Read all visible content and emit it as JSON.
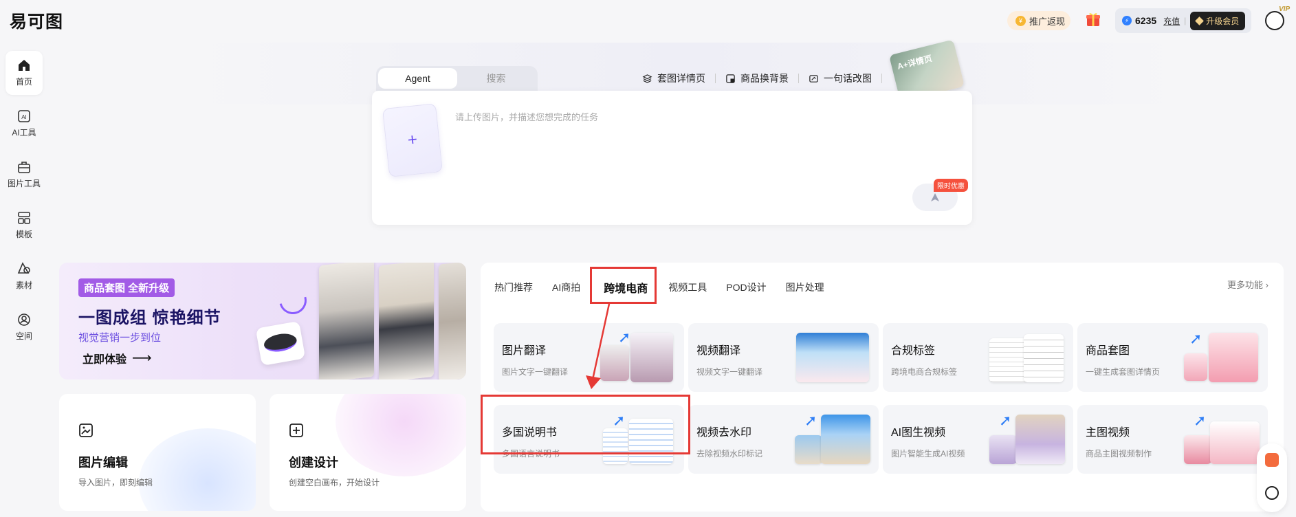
{
  "header": {
    "logo": "易可图",
    "promo_label": "推广返现",
    "credits": "6235",
    "recharge_label": "充值",
    "upgrade_label": "升级会员",
    "vip_tag": "VIP"
  },
  "sidebar": {
    "items": [
      {
        "label": "首页",
        "icon": "home-icon"
      },
      {
        "label": "AI工具",
        "icon": "ai-icon"
      },
      {
        "label": "图片工具",
        "icon": "toolbox-icon"
      },
      {
        "label": "模板",
        "icon": "template-icon"
      },
      {
        "label": "素材",
        "icon": "shapes-icon"
      },
      {
        "label": "空间",
        "icon": "user-space-icon"
      }
    ]
  },
  "agent": {
    "tabs": [
      "Agent",
      "搜索"
    ],
    "quick_links": [
      "套图详情页",
      "商品换背景",
      "一句话改图"
    ],
    "aplus_label": "A+详情页",
    "placeholder": "请上传图片，并描述您想完成的任务",
    "upload_plus": "+",
    "limited_badge": "限时优惠"
  },
  "banner": {
    "badge": "商品套图 全新升级",
    "title": "一图成组 惊艳细节",
    "subtitle": "视觉营销一步到位",
    "cta": "立即体验",
    "cta_arrow": "⟶"
  },
  "quick_cards": [
    {
      "title": "图片编辑",
      "subtitle": "导入图片，即刻编辑",
      "icon": "image-edit-icon"
    },
    {
      "title": "创建设计",
      "subtitle": "创建空白画布，开始设计",
      "icon": "add-square-icon"
    }
  ],
  "features": {
    "categories": [
      "热门推荐",
      "AI商拍",
      "跨境电商",
      "视频工具",
      "POD设计",
      "图片处理"
    ],
    "active_category": "跨境电商",
    "more_label": "更多功能 ›",
    "cards": [
      {
        "title": "图片翻译",
        "subtitle": "图片文字一键翻译"
      },
      {
        "title": "视频翻译",
        "subtitle": "视频文字一键翻译"
      },
      {
        "title": "合规标签",
        "subtitle": "跨境电商合规标签"
      },
      {
        "title": "商品套图",
        "subtitle": "一键生成套图详情页"
      },
      {
        "title": "多国说明书",
        "subtitle": "多国语言说明书"
      },
      {
        "title": "视频去水印",
        "subtitle": "去除视频水印标记"
      },
      {
        "title": "AI图生视频",
        "subtitle": "图片智能生成AI视频"
      },
      {
        "title": "主图视频",
        "subtitle": "商品主图视频制作"
      }
    ]
  },
  "colors": {
    "accent_purple": "#8a5cff",
    "highlight_red": "#e53935",
    "banner_badge": "#a25be6"
  }
}
